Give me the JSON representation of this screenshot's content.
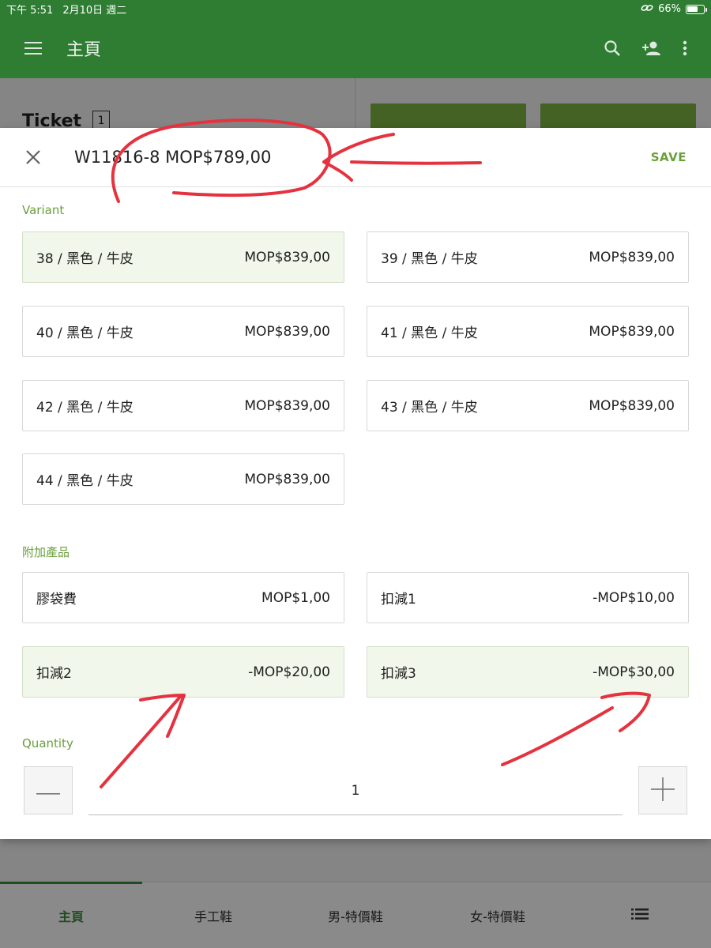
{
  "status_bar": {
    "time": "下午 5:51",
    "date": "2月10日 週二",
    "battery": "66%",
    "battery_level": 0.66
  },
  "app_bar": {
    "title": "主頁",
    "icons": [
      "menu-icon",
      "search-icon",
      "add-person-icon",
      "more-vert-icon"
    ]
  },
  "background": {
    "ticket_label": "Ticket",
    "ticket_count": "1",
    "tabs": [
      {
        "label": "主頁",
        "active": true
      },
      {
        "label": "手工鞋",
        "active": false
      },
      {
        "label": "男-特價鞋",
        "active": false
      },
      {
        "label": "女-特價鞋",
        "active": false
      }
    ],
    "tab_menu_icon": "list-icon"
  },
  "dialog": {
    "title": "W11816-8 MOP$789,00",
    "save_label": "SAVE",
    "variant_label": "Variant",
    "variants": [
      {
        "name": "38 / 黑色 / 牛皮",
        "price": "MOP$839,00",
        "selected": true
      },
      {
        "name": "39 / 黑色 / 牛皮",
        "price": "MOP$839,00",
        "selected": false
      },
      {
        "name": "40 / 黑色 / 牛皮",
        "price": "MOP$839,00",
        "selected": false
      },
      {
        "name": "41 / 黑色 / 牛皮",
        "price": "MOP$839,00",
        "selected": false
      },
      {
        "name": "42 / 黑色 / 牛皮",
        "price": "MOP$839,00",
        "selected": false
      },
      {
        "name": "43 / 黑色 / 牛皮",
        "price": "MOP$839,00",
        "selected": false
      },
      {
        "name": "44 / 黑色 / 牛皮",
        "price": "MOP$839,00",
        "selected": false
      }
    ],
    "addons_label": "附加產品",
    "addons": [
      {
        "name": "膠袋費",
        "price": "MOP$1,00",
        "selected": false
      },
      {
        "name": "扣減1",
        "price": "-MOP$10,00",
        "selected": false
      },
      {
        "name": "扣減2",
        "price": "-MOP$20,00",
        "selected": true
      },
      {
        "name": "扣減3",
        "price": "-MOP$30,00",
        "selected": true
      }
    ],
    "quantity_label": "Quantity",
    "quantity_value": "1"
  },
  "colors": {
    "primary": "#2f7d33",
    "accent": "#6a9f3c",
    "selected_bg": "#f1f7ea",
    "annotation_red": "#e5323f"
  }
}
